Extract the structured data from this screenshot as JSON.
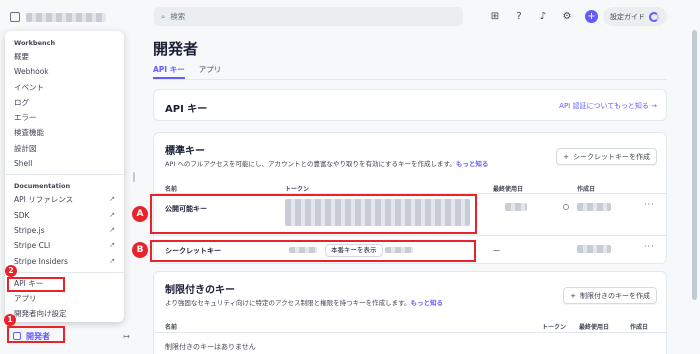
{
  "sidebar": {
    "workbench_heading": "Workbench",
    "workbench_items": [
      "概要",
      "Webhook",
      "イベント",
      "ログ",
      "エラー",
      "検査機能",
      "設計図",
      "Shell"
    ],
    "documentation_heading": "Documentation",
    "doc_items": [
      {
        "label": "API リファレンス",
        "external": true
      },
      {
        "label": "SDK",
        "external": true
      },
      {
        "label": "Stripe.js",
        "external": true
      },
      {
        "label": "Stripe CLI",
        "external": true
      },
      {
        "label": "Stripe Insiders",
        "external": true
      }
    ],
    "extra_items": [
      "API キー",
      "アプリ",
      "開発者向け設定"
    ],
    "bottom_item": "開発者",
    "collapse_icon": "sidebar-collapse-icon"
  },
  "topbar": {
    "search_placeholder": "検索",
    "guide_label": "設定ガイド",
    "icons": [
      "apps-icon",
      "help-icon",
      "bell-icon",
      "gear-icon",
      "plus-icon"
    ]
  },
  "page": {
    "title": "開発者",
    "tabs": [
      "API キー",
      "アプリ"
    ],
    "active_tab": "API キー"
  },
  "api_card": {
    "title": "API キー",
    "link": "API 認証についてもっと知る →"
  },
  "standard_keys": {
    "title": "標準キー",
    "description": "API へのフルアクセスを可能にし、アカウントとの豊富なやり取りを有効にするキーを作成します。",
    "learn_more": "もっと知る",
    "create_button": "シークレットキーを作成",
    "columns": [
      "名前",
      "トークン",
      "最終使用日",
      "作成日"
    ],
    "rows": [
      {
        "name": "公開可能キー",
        "last_used": "",
        "created": ""
      },
      {
        "name": "シークレットキー",
        "reveal": "本番キーを表示",
        "last_used": "—",
        "created": ""
      }
    ]
  },
  "restricted_keys": {
    "title": "制限付きのキー",
    "description": "より強固なセキュリティ向けに特定のアクセス制限と権限を持つキーを作成します。",
    "learn_more": "もっと知る",
    "create_button": "制限付きのキーを作成",
    "columns": [
      "名前",
      "トークン",
      "最終使用日",
      "作成日"
    ],
    "empty": "制限付きのキーはありません"
  },
  "annotations": {
    "step1": "1",
    "step2": "2",
    "markA": "A",
    "markB": "B",
    "color": "#e8232b"
  },
  "colors": {
    "accent": "#635bff",
    "annotation": "#e8232b"
  }
}
